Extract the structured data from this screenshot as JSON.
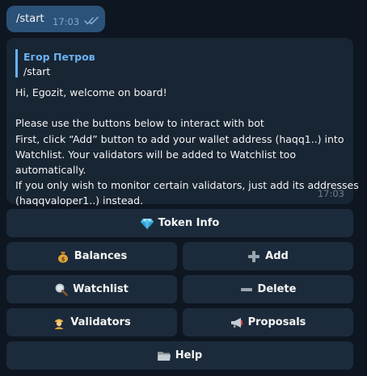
{
  "outgoing": {
    "text": "/start",
    "time": "17:03"
  },
  "incoming": {
    "reply": {
      "name": "Егор Петров",
      "text": "/start"
    },
    "lines": [
      "Hi, Egozit, welcome on board!",
      "",
      "Please use the buttons below to interact with bot",
      "First, click “Add” button to add your wallet address (haqq1..) into",
      "Watchlist. Your validators will be added to Watchlist too",
      "automatically.",
      "If you only wish to monitor certain validators, just add its addresses",
      "(haqqvaloper1..) instead."
    ],
    "time": "17:03"
  },
  "keyboard": {
    "token_info": {
      "label": "Token Info",
      "icon": "gem-icon"
    },
    "balances": {
      "label": "Balances",
      "icon": "money-bag-icon"
    },
    "add": {
      "label": "Add",
      "icon": "plus-icon"
    },
    "watchlist": {
      "label": "Watchlist",
      "icon": "magnifier-icon"
    },
    "delete": {
      "label": "Delete",
      "icon": "minus-icon"
    },
    "validators": {
      "label": "Validators",
      "icon": "guard-icon"
    },
    "proposals": {
      "label": "Proposals",
      "icon": "megaphone-icon"
    },
    "help": {
      "label": "Help",
      "icon": "folder-icon"
    }
  },
  "colors": {
    "background": "#0e1621",
    "outgoing_bubble": "#2b5278",
    "incoming_bubble": "#182533",
    "button": "#1c2b3b",
    "accent": "#6ab3f3"
  }
}
